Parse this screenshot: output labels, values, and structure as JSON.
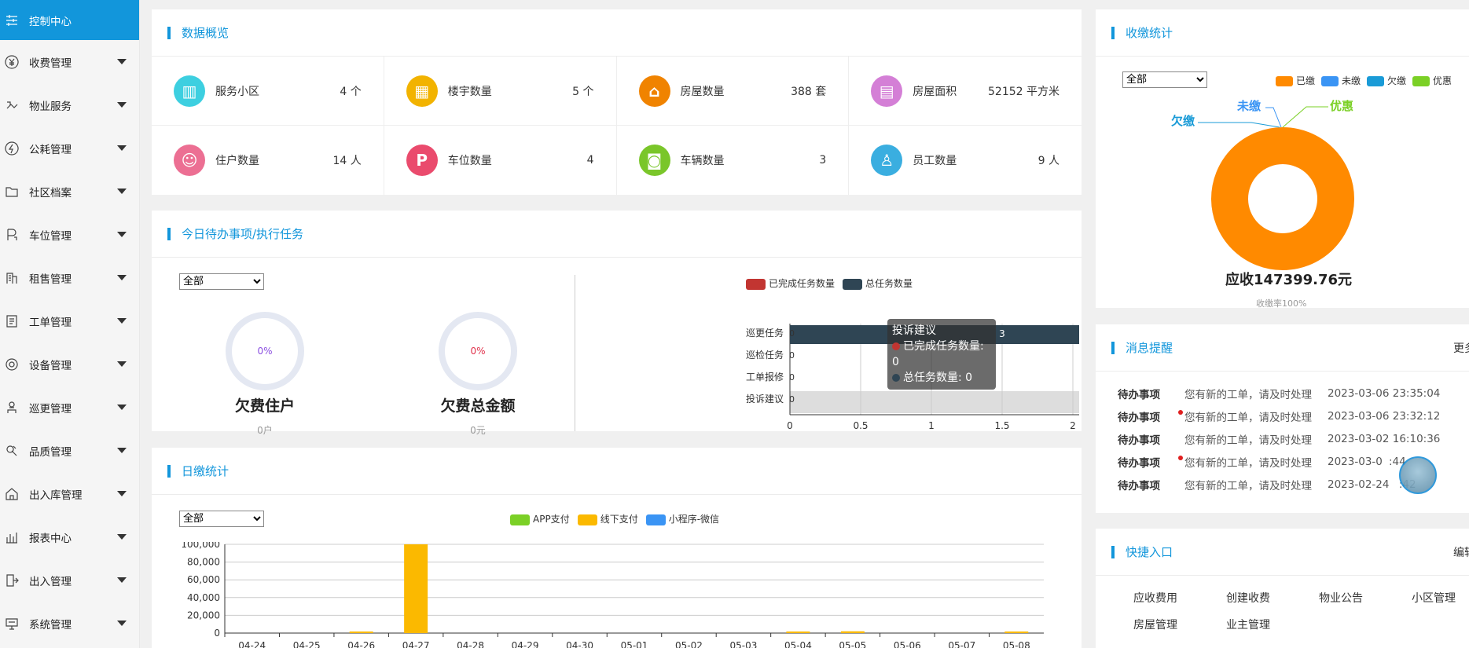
{
  "sidebar": {
    "items": [
      {
        "label": "控制中心",
        "icon": "sliders-icon",
        "active": true
      },
      {
        "label": "收费管理",
        "icon": "yen-icon"
      },
      {
        "label": "物业服务",
        "icon": "service-icon"
      },
      {
        "label": "公耗管理",
        "icon": "energy-icon"
      },
      {
        "label": "社区档案",
        "icon": "folder-icon"
      },
      {
        "label": "车位管理",
        "icon": "parking-icon"
      },
      {
        "label": "租售管理",
        "icon": "building-icon"
      },
      {
        "label": "工单管理",
        "icon": "list-icon"
      },
      {
        "label": "设备管理",
        "icon": "device-icon"
      },
      {
        "label": "巡更管理",
        "icon": "patrol-icon"
      },
      {
        "label": "品质管理",
        "icon": "quality-icon"
      },
      {
        "label": "出入库管理",
        "icon": "warehouse-icon"
      },
      {
        "label": "报表中心",
        "icon": "report-icon"
      },
      {
        "label": "出入管理",
        "icon": "exit-icon"
      },
      {
        "label": "系统管理",
        "icon": "system-icon"
      }
    ]
  },
  "overview": {
    "title": "数据概览",
    "cells": [
      {
        "label": "服务小区",
        "value": "4 个",
        "color": "#3dcfe0",
        "icon": "building-icon"
      },
      {
        "label": "楼宇数量",
        "value": "5 个",
        "color": "#f2b300",
        "icon": "tower-icon"
      },
      {
        "label": "房屋数量",
        "value": "388 套",
        "color": "#f08300",
        "icon": "house-icon"
      },
      {
        "label": "房屋面积",
        "value": "52152 平方米",
        "color": "#d47fd6",
        "icon": "area-icon"
      },
      {
        "label": "住户数量",
        "value": "14 人",
        "color": "#ec6f93",
        "icon": "people-icon"
      },
      {
        "label": "车位数量",
        "value": "4",
        "color": "#ea4b6d",
        "icon": "parking-p-icon"
      },
      {
        "label": "车辆数量",
        "value": "3",
        "color": "#7ac62a",
        "icon": "car-icon"
      },
      {
        "label": "员工数量",
        "value": "9 人",
        "color": "#3aaee0",
        "icon": "staff-icon"
      }
    ]
  },
  "tasks": {
    "title": "今日待办事项/执行任务",
    "select_value": "全部",
    "gauges": [
      {
        "percent": "0%",
        "title": "欠费住户",
        "sub": "0户",
        "color": "#8a4ee0"
      },
      {
        "percent": "0%",
        "title": "欠费总金额",
        "sub": "0元",
        "color": "#e0304a"
      }
    ],
    "legend": [
      {
        "name": "已完成任务数量",
        "color": "#c23531"
      },
      {
        "name": "总任务数量",
        "color": "#2f4554"
      }
    ],
    "tooltip": {
      "title": "投诉建议",
      "lines": [
        "已完成任务数量: 0",
        "总任务数量: 0"
      ]
    }
  },
  "daily": {
    "title": "日缴统计",
    "select_value": "全部",
    "legend": [
      {
        "name": "APP支付",
        "color": "#7bd026"
      },
      {
        "name": "线下支付",
        "color": "#fbb900"
      },
      {
        "name": "小程序-微信",
        "color": "#3a94f4"
      }
    ]
  },
  "payment": {
    "title": "收缴统计",
    "select_value": "全部",
    "legend": [
      {
        "name": "已缴",
        "color": "#ff8a00"
      },
      {
        "name": "未缴",
        "color": "#3a94f4"
      },
      {
        "name": "欠缴",
        "color": "#1a9bd7"
      },
      {
        "name": "优惠",
        "color": "#7bd026"
      }
    ],
    "labels": {
      "qianjiao": "欠缴",
      "weijiao": "未缴",
      "youhui": "优惠"
    },
    "total": "应收147399.76元",
    "rate": "收缴率100%"
  },
  "messages": {
    "title": "消息提醒",
    "more": "更多",
    "items": [
      {
        "type": "待办事项",
        "text": "您有新的工单，请及时处理",
        "time": "2023-03-06 23:35:04",
        "dot": false
      },
      {
        "type": "待办事项",
        "text": "您有新的工单，请及时处理",
        "time": "2023-03-06 23:32:12",
        "dot": true
      },
      {
        "type": "待办事项",
        "text": "您有新的工单，请及时处理",
        "time": "2023-03-02 16:10:36",
        "dot": false
      },
      {
        "type": "待办事项",
        "text": "您有新的工单，请及时处理",
        "time": "2023-03-0   :44",
        "dot": true
      },
      {
        "type": "待办事项",
        "text": "您有新的工单，请及时处理",
        "time": "2023-02-24    :42",
        "dot": false
      }
    ]
  },
  "quick": {
    "title": "快捷入口",
    "edit": "编辑",
    "items": [
      "应收费用",
      "创建收费",
      "物业公告",
      "小区管理",
      "房屋管理",
      "业主管理"
    ]
  },
  "chart_data": [
    {
      "type": "bar",
      "orientation": "horizontal",
      "categories": [
        "巡更任务",
        "巡检任务",
        "工单报修",
        "投诉建议"
      ],
      "series": [
        {
          "name": "已完成任务数量",
          "values": [
            0,
            0,
            0,
            0
          ]
        },
        {
          "name": "总任务数量",
          "values": [
            3,
            0,
            0,
            0
          ]
        }
      ],
      "xlim": [
        0,
        3
      ],
      "xticks": [
        "0",
        "0.5",
        "1",
        "1.5",
        "2",
        "2.5",
        "3"
      ],
      "data_labels": [
        "3"
      ],
      "grid": true,
      "legend": "top-center"
    },
    {
      "type": "bar",
      "categories": [
        "04-24",
        "04-25",
        "04-26",
        "04-27",
        "04-28",
        "04-29",
        "04-30",
        "05-01",
        "05-02",
        "05-03",
        "05-04",
        "05-05",
        "05-06",
        "05-07",
        "05-08"
      ],
      "series": [
        {
          "name": "APP支付",
          "values": [
            0,
            0,
            0,
            0,
            0,
            0,
            0,
            0,
            0,
            0,
            0,
            0,
            0,
            0,
            0
          ]
        },
        {
          "name": "线下支付",
          "values": [
            0,
            0,
            300,
            100000,
            0,
            0,
            0,
            0,
            0,
            0,
            1500,
            2000,
            0,
            0,
            300
          ]
        },
        {
          "name": "小程序-微信",
          "values": [
            0,
            0,
            0,
            0,
            0,
            0,
            0,
            0,
            0,
            0,
            0,
            0,
            0,
            0,
            0
          ]
        }
      ],
      "ylim": [
        0,
        100000
      ],
      "yticks": [
        "0",
        "20,000",
        "40,000",
        "60,000",
        "80,000",
        "100,000"
      ],
      "grid": true,
      "legend": "top-center"
    },
    {
      "type": "pie",
      "donut": true,
      "slices": [
        {
          "name": "已缴",
          "value": 147399.76
        },
        {
          "name": "未缴",
          "value": 0
        },
        {
          "name": "欠缴",
          "value": 0
        },
        {
          "name": "优惠",
          "value": 0
        }
      ]
    }
  ]
}
